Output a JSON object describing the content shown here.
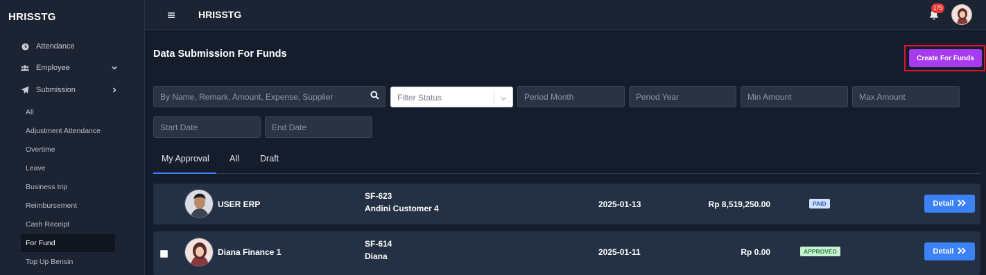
{
  "sidebar": {
    "brand": "HRISSTG",
    "nav": [
      {
        "label": "Attendance",
        "icon": "clock-icon"
      },
      {
        "label": "Employee",
        "icon": "users-icon"
      },
      {
        "label": "Submission",
        "icon": "send-icon"
      }
    ],
    "submission_items": [
      {
        "label": "All"
      },
      {
        "label": "Adjustment Attendance"
      },
      {
        "label": "Overtime"
      },
      {
        "label": "Leave"
      },
      {
        "label": "Business trip"
      },
      {
        "label": "Reimbursement"
      },
      {
        "label": "Cash Receipt"
      },
      {
        "label": "For Fund"
      },
      {
        "label": "Top Up Bensin"
      }
    ],
    "active_item": "For Fund"
  },
  "topbar": {
    "title": "HRISSTG",
    "notification_count": "175"
  },
  "main": {
    "title": "Data Submission For Funds",
    "create_button": "Create For Funds",
    "filters": {
      "search_placeholder": "By Name, Remark, Amount, Expense, Supplier",
      "status_placeholder": "Filter Status",
      "period_month_placeholder": "Period Month",
      "period_year_placeholder": "Period Year",
      "min_amount_placeholder": "Min Amount",
      "max_amount_placeholder": "Max Amount",
      "start_date_placeholder": "Start Date",
      "end_date_placeholder": "End Date"
    },
    "tabs": [
      {
        "label": "My Approval"
      },
      {
        "label": "All"
      },
      {
        "label": "Draft"
      }
    ],
    "active_tab": "My Approval",
    "rows": [
      {
        "name": "USER ERP",
        "code": "SF-623",
        "customer": "Andini Customer 4",
        "date": "2025-01-13",
        "amount": "Rp 8,519,250.00",
        "status": "PAID",
        "action": "Detail",
        "has_checkbox": false
      },
      {
        "name": "Diana Finance 1",
        "code": "SF-614",
        "customer": "Diana",
        "date": "2025-01-11",
        "amount": "Rp 0.00",
        "status": "APPROVED",
        "action": "Detail",
        "has_checkbox": true
      }
    ]
  },
  "colors": {
    "accent_purple": "#a73bf0",
    "primary_blue": "#3b82f6",
    "highlight_red": "#e0142a",
    "background": "#151c2c"
  }
}
